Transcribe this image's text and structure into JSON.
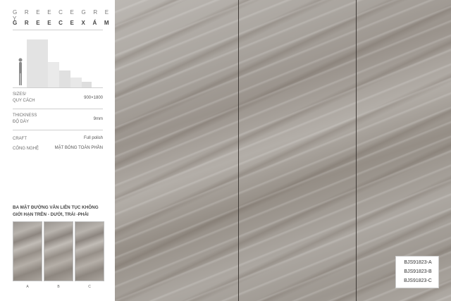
{
  "title_en": "G R E E C E G R E Y",
  "title_vi": "G R E E C E X Á M",
  "specs": [
    {
      "label_en": "SIZES/",
      "label_vi": "QUY CÁCH",
      "value": "900×1800"
    },
    {
      "label_en": "THICKNESS",
      "label_vi": "ĐỘ DÀY",
      "value": "9mm"
    },
    {
      "label_en": "CRAFT",
      "label_vi": "CÔNG NGHỆ",
      "value_en": "Full polish",
      "value_vi": "MẶT BÓNG TOÀN PHẦN"
    }
  ],
  "description": "BA MẶT ĐƯỜNG VÂN LIÊN TỤC KHÔNG GIỚI HẠN TRÊN - DƯỚI, TRÁI -PHẢI",
  "thumbnails": [
    {
      "label": "A"
    },
    {
      "label": "B"
    },
    {
      "label": "C"
    }
  ],
  "codes": [
    "BJS91823-A",
    "BJS91823-B",
    "BJS91823-C"
  ]
}
